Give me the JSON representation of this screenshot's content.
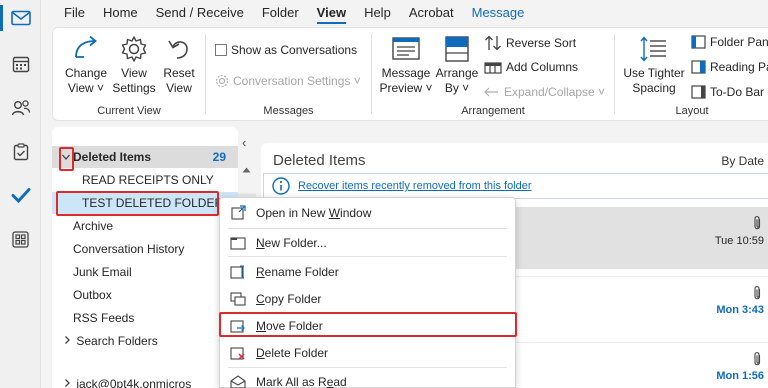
{
  "rail": {
    "items": [
      {
        "icon": "mail-icon",
        "active": true
      },
      {
        "icon": "calendar-icon",
        "active": false
      },
      {
        "icon": "people-icon",
        "active": false
      },
      {
        "icon": "tasks-icon",
        "active": false
      },
      {
        "icon": "todo-check-icon",
        "active": false
      },
      {
        "icon": "apps-icon",
        "active": false
      }
    ]
  },
  "tabs": [
    "File",
    "Home",
    "Send / Receive",
    "Folder",
    "View",
    "Help",
    "Acrobat",
    "Message"
  ],
  "active_tab": "View",
  "ribbon": {
    "current_view": {
      "change_view": "Change\nView ˅",
      "view_settings": "View\nSettings",
      "reset_view": "Reset\nView",
      "label": "Current View"
    },
    "messages": {
      "show_as_conversations": "Show as Conversations",
      "conversation_settings": "Conversation Settings ˅",
      "label": "Messages"
    },
    "arrangement": {
      "message_preview": "Message\nPreview ˅",
      "arrange_by": "Arrange\nBy ˅",
      "reverse_sort": "Reverse Sort",
      "add_columns": "Add Columns",
      "expand_collapse": "Expand/Collapse ˅",
      "label": "Arrangement"
    },
    "layout": {
      "use_tighter_spacing": "Use Tighter\nSpacing",
      "folder_pane": "Folder Pane",
      "reading_pane": "Reading Pa",
      "todo_bar": "To-Do Bar ˅",
      "label": "Layout"
    }
  },
  "folders": {
    "collapse_arrow": "‹",
    "deleted_items": {
      "label": "Deleted Items",
      "count": "29"
    },
    "sub": [
      "READ RECEIPTS ONLY",
      "TEST DELETED FOLDER"
    ],
    "items": [
      "Archive",
      "Conversation History",
      "Junk Email",
      "Outbox",
      "RSS Feeds",
      "Search Folders"
    ],
    "account": "jack@0pt4k.onmicros"
  },
  "message_list": {
    "title": "Deleted Items",
    "sort": "By Date",
    "recover_link": "Recover items recently removed from this folder",
    "rows": [
      {
        "date": "Tue 10:59",
        "attachment": true
      },
      {
        "date": "Mon 3:43",
        "attachment": true
      },
      {
        "date": "Mon 1:56",
        "attachment": true
      }
    ]
  },
  "context_menu": {
    "items": [
      {
        "pre": "Open in New ",
        "ul": "W",
        "post": "indow",
        "icon": "new-window-icon"
      },
      {
        "pre": "",
        "ul": "N",
        "post": "ew Folder...",
        "icon": "new-folder-icon"
      },
      {
        "pre": "",
        "ul": "R",
        "post": "ename Folder",
        "icon": "rename-folder-icon"
      },
      {
        "pre": "",
        "ul": "C",
        "post": "opy Folder",
        "icon": "copy-folder-icon"
      },
      {
        "pre": "",
        "ul": "M",
        "post": "ove Folder",
        "icon": "move-folder-icon"
      },
      {
        "pre": "",
        "ul": "D",
        "post": "elete Folder",
        "icon": "delete-folder-icon"
      },
      {
        "pre": "Mark All as R",
        "ul": "e",
        "post": "ad",
        "icon": "mark-read-icon"
      }
    ]
  },
  "colors": {
    "accent": "#0f6cbd",
    "highlight": "#e02a2a",
    "selected_bg": "#cde6f7"
  }
}
